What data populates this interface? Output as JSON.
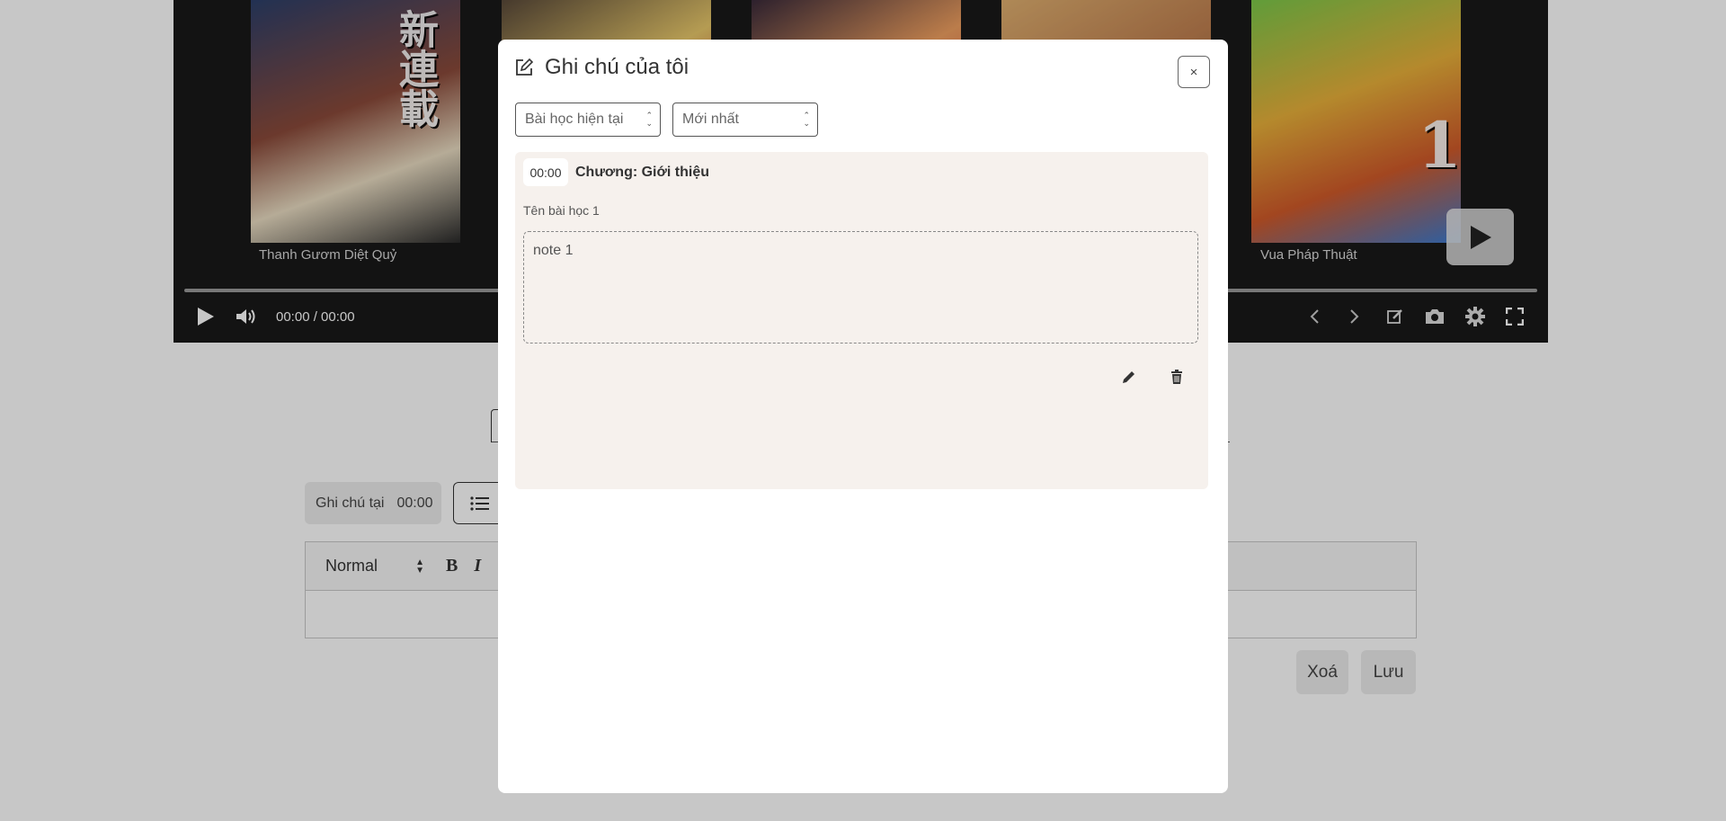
{
  "video": {
    "covers": [
      {
        "caption": "Thanh Gươm Diệt Quỷ",
        "deco": "新連載"
      },
      {
        "caption": "",
        "deco": ""
      },
      {
        "caption": "",
        "deco": ""
      },
      {
        "caption": "",
        "deco": ""
      },
      {
        "caption": "Vua Pháp Thuật",
        "deco": "1"
      }
    ],
    "time": "00:00 / 00:00"
  },
  "page": {
    "note_at_label": "Ghi chú tại",
    "note_at_time": "00:00",
    "editor_format": "Normal",
    "bold": "B",
    "italic": "I",
    "delete_label": "Xoá",
    "save_label": "Lưu"
  },
  "modal": {
    "title": "Ghi chú của tôi",
    "close": "×",
    "filter_lesson": "Bài học hiện tại",
    "filter_sort": "Mới nhất",
    "notes": [
      {
        "time": "00:00",
        "chapter": "Chương: Giới thiệu",
        "lesson": "Tên bài học 1",
        "content": "note 1"
      }
    ]
  },
  "colors": {
    "card_bg": "#f6f1ed",
    "video_bg": "#191919",
    "backdrop": "rgba(0,0,0,0.22)"
  }
}
